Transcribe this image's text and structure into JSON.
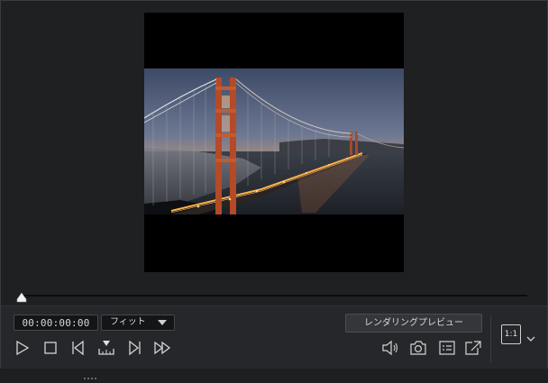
{
  "player": {
    "timecode": "00:00:00:00",
    "zoom": {
      "selected": "フィット"
    },
    "render_preview_label": "レンダリングプレビュー",
    "aspect_ratio_label": "1:1",
    "playhead_position": 0
  },
  "icons": {
    "play": "play-icon",
    "stop": "stop-icon",
    "previous_frame": "previous-frame-icon",
    "split_marker": "split-marker-icon",
    "next_frame": "next-frame-icon",
    "fast_forward": "fast-forward-icon",
    "volume": "volume-icon",
    "snapshot": "camera-icon",
    "subtitles": "subtitles-icon",
    "external_preview": "external-window-icon",
    "ratio_dropdown": "chevron-down-icon"
  },
  "colors": {
    "panel_bg": "#1f2022",
    "controls_bg": "#26272a",
    "icon": "#cfcfcf"
  }
}
